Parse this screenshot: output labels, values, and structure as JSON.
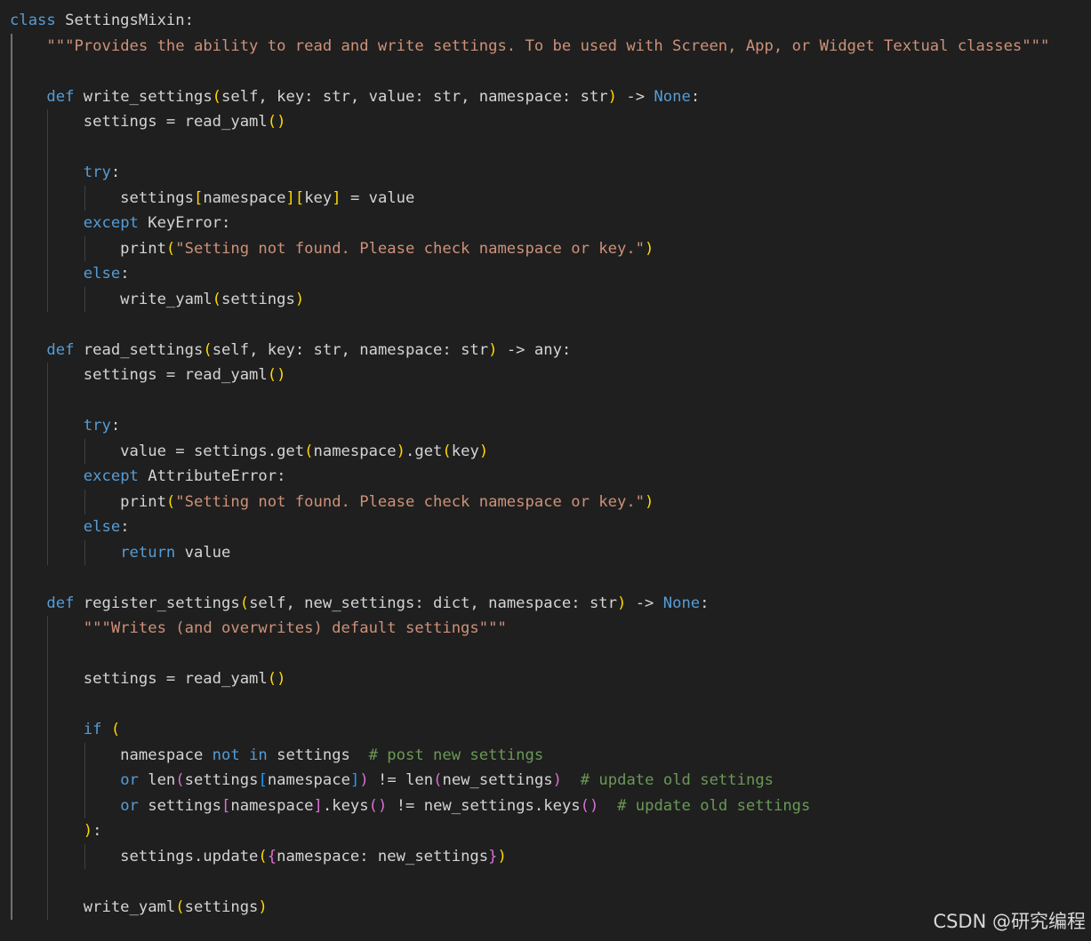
{
  "theme": {
    "background": "#1f1f1f",
    "default_text": "#d4d4d4",
    "keyword": "#569cd6",
    "string": "#ce9178",
    "comment": "#6a9955",
    "bracket_level_1": "#ffd700",
    "bracket_level_2": "#da70d6",
    "bracket_level_3": "#179fff"
  },
  "code": {
    "language": "python",
    "lines": [
      [
        [
          "class",
          "kw"
        ],
        [
          " SettingsMixin:",
          "txt"
        ]
      ],
      [
        [
          "    ",
          "txt"
        ],
        [
          "\"\"\"Provides the ability to read and write settings. To be used with Screen, App, or Widget Textual classes\"\"\"",
          "str"
        ]
      ],
      [],
      [
        [
          "    ",
          "txt"
        ],
        [
          "def",
          "kw"
        ],
        [
          " write_settings",
          "txt"
        ],
        [
          "(",
          "b1"
        ],
        [
          "self, key: str, value: str, namespace: str",
          "txt"
        ],
        [
          ")",
          "b1"
        ],
        [
          " -> ",
          "txt"
        ],
        [
          "None",
          "kw"
        ],
        [
          ":",
          "txt"
        ]
      ],
      [
        [
          "        settings = read_yaml",
          "txt"
        ],
        [
          "()",
          "b1"
        ]
      ],
      [],
      [
        [
          "        ",
          "txt"
        ],
        [
          "try",
          "ctl"
        ],
        [
          ":",
          "txt"
        ]
      ],
      [
        [
          "            settings",
          "txt"
        ],
        [
          "[",
          "b1"
        ],
        [
          "namespace",
          "txt"
        ],
        [
          "]",
          "b1"
        ],
        [
          "[",
          "b1"
        ],
        [
          "key",
          "txt"
        ],
        [
          "]",
          "b1"
        ],
        [
          " = value",
          "txt"
        ]
      ],
      [
        [
          "        ",
          "txt"
        ],
        [
          "except",
          "ctl"
        ],
        [
          " KeyError:",
          "txt"
        ]
      ],
      [
        [
          "            print",
          "txt"
        ],
        [
          "(",
          "b1"
        ],
        [
          "\"Setting not found. Please check namespace or key.\"",
          "str"
        ],
        [
          ")",
          "b1"
        ]
      ],
      [
        [
          "        ",
          "txt"
        ],
        [
          "else",
          "ctl"
        ],
        [
          ":",
          "txt"
        ]
      ],
      [
        [
          "            write_yaml",
          "txt"
        ],
        [
          "(",
          "b1"
        ],
        [
          "settings",
          "txt"
        ],
        [
          ")",
          "b1"
        ]
      ],
      [],
      [
        [
          "    ",
          "txt"
        ],
        [
          "def",
          "kw"
        ],
        [
          " read_settings",
          "txt"
        ],
        [
          "(",
          "b1"
        ],
        [
          "self, key: str, namespace: str",
          "txt"
        ],
        [
          ")",
          "b1"
        ],
        [
          " -> any:",
          "txt"
        ]
      ],
      [
        [
          "        settings = read_yaml",
          "txt"
        ],
        [
          "()",
          "b1"
        ]
      ],
      [],
      [
        [
          "        ",
          "txt"
        ],
        [
          "try",
          "ctl"
        ],
        [
          ":",
          "txt"
        ]
      ],
      [
        [
          "            value = settings.get",
          "txt"
        ],
        [
          "(",
          "b1"
        ],
        [
          "namespace",
          "txt"
        ],
        [
          ")",
          "b1"
        ],
        [
          ".get",
          "txt"
        ],
        [
          "(",
          "b1"
        ],
        [
          "key",
          "txt"
        ],
        [
          ")",
          "b1"
        ]
      ],
      [
        [
          "        ",
          "txt"
        ],
        [
          "except",
          "ctl"
        ],
        [
          " AttributeError:",
          "txt"
        ]
      ],
      [
        [
          "            print",
          "txt"
        ],
        [
          "(",
          "b1"
        ],
        [
          "\"Setting not found. Please check namespace or key.\"",
          "str"
        ],
        [
          ")",
          "b1"
        ]
      ],
      [
        [
          "        ",
          "txt"
        ],
        [
          "else",
          "ctl"
        ],
        [
          ":",
          "txt"
        ]
      ],
      [
        [
          "            ",
          "txt"
        ],
        [
          "return",
          "ctl"
        ],
        [
          " value",
          "txt"
        ]
      ],
      [],
      [
        [
          "    ",
          "txt"
        ],
        [
          "def",
          "kw"
        ],
        [
          " register_settings",
          "txt"
        ],
        [
          "(",
          "b1"
        ],
        [
          "self, new_settings: dict, namespace: str",
          "txt"
        ],
        [
          ")",
          "b1"
        ],
        [
          " -> ",
          "txt"
        ],
        [
          "None",
          "kw"
        ],
        [
          ":",
          "txt"
        ]
      ],
      [
        [
          "        ",
          "txt"
        ],
        [
          "\"\"\"Writes (and overwrites) default settings\"\"\"",
          "str"
        ]
      ],
      [],
      [
        [
          "        settings = read_yaml",
          "txt"
        ],
        [
          "()",
          "b1"
        ]
      ],
      [],
      [
        [
          "        ",
          "txt"
        ],
        [
          "if",
          "ctl"
        ],
        [
          " ",
          "txt"
        ],
        [
          "(",
          "b1"
        ]
      ],
      [
        [
          "            namespace ",
          "txt"
        ],
        [
          "not",
          "kw"
        ],
        [
          " ",
          "txt"
        ],
        [
          "in",
          "kw"
        ],
        [
          " settings  ",
          "txt"
        ],
        [
          "# post new settings",
          "cmt"
        ]
      ],
      [
        [
          "            ",
          "txt"
        ],
        [
          "or",
          "kw"
        ],
        [
          " len",
          "txt"
        ],
        [
          "(",
          "b2"
        ],
        [
          "settings",
          "txt"
        ],
        [
          "[",
          "b3"
        ],
        [
          "namespace",
          "txt"
        ],
        [
          "]",
          "b3"
        ],
        [
          ")",
          "b2"
        ],
        [
          " != len",
          "txt"
        ],
        [
          "(",
          "b2"
        ],
        [
          "new_settings",
          "txt"
        ],
        [
          ")",
          "b2"
        ],
        [
          "  ",
          "txt"
        ],
        [
          "# update old settings",
          "cmt"
        ]
      ],
      [
        [
          "            ",
          "txt"
        ],
        [
          "or",
          "kw"
        ],
        [
          " settings",
          "txt"
        ],
        [
          "[",
          "b2"
        ],
        [
          "namespace",
          "txt"
        ],
        [
          "]",
          "b2"
        ],
        [
          ".keys",
          "txt"
        ],
        [
          "()",
          "b2"
        ],
        [
          " != new_settings.keys",
          "txt"
        ],
        [
          "()",
          "b2"
        ],
        [
          "  ",
          "txt"
        ],
        [
          "# update old settings",
          "cmt"
        ]
      ],
      [
        [
          "        ",
          "txt"
        ],
        [
          ")",
          "b1"
        ],
        [
          ":",
          "txt"
        ]
      ],
      [
        [
          "            settings.update",
          "txt"
        ],
        [
          "(",
          "b1"
        ],
        [
          "{",
          "b2"
        ],
        [
          "namespace: new_settings",
          "txt"
        ],
        [
          "}",
          "b2"
        ],
        [
          ")",
          "b1"
        ]
      ],
      [],
      [
        [
          "        write_yaml",
          "txt"
        ],
        [
          "(",
          "b1"
        ],
        [
          "settings",
          "txt"
        ],
        [
          ")",
          "b1"
        ]
      ]
    ]
  },
  "watermark": "CSDN @研究编程"
}
